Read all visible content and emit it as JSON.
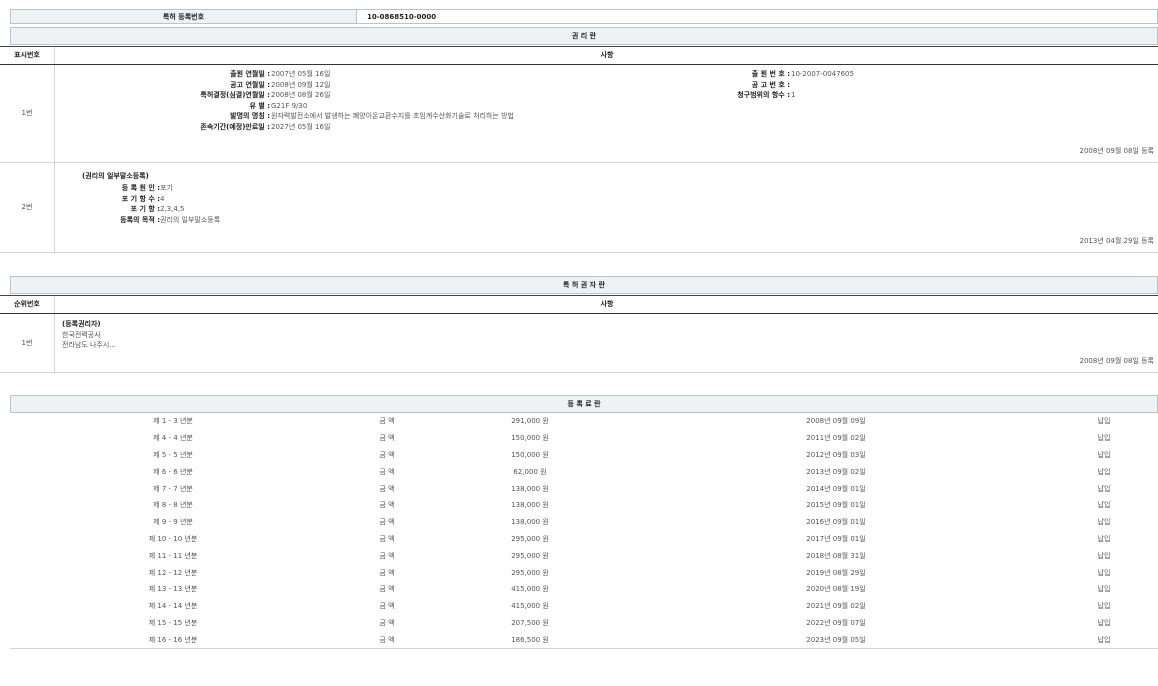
{
  "patent_number_label": "특허 등록번호",
  "patent_number_value": "10-0868510-0000",
  "section1": {
    "title": "권 리 란",
    "col_no": "표시번호",
    "col_detail": "사항",
    "entry1": {
      "no": "1번",
      "left": [
        {
          "k": "출원 연월일 :",
          "v": "2007년 05월 16일"
        },
        {
          "k": "공고 연월일 :",
          "v": "2008년 09월 12일"
        },
        {
          "k": "특허결정(심결)연월일 :",
          "v": "2008년 08월 26일"
        },
        {
          "k": "유 별 :",
          "v": "G21F 9/30"
        },
        {
          "k": "발명의 명칭 :",
          "v": "원자력발전소에서 발생하는 폐양이온교환수지를 초임계수산화기술로 처리하는 방법"
        },
        {
          "k": "존속기간(예정)만료일 :",
          "v": "2027년 05월 16일"
        }
      ],
      "right": [
        {
          "k": "출 원 번 호 :",
          "v": "10-2007-0047605"
        },
        {
          "k": "공 고 번 호 :",
          "v": ""
        },
        {
          "k": "청구범위의 항수 :",
          "v": "1"
        }
      ],
      "date": "2008년 09월 08일 등록"
    },
    "entry2": {
      "no": "2번",
      "heading": "(권리의 일부말소등록)",
      "items": [
        {
          "k": "등 록 원 인 :",
          "v": "포기"
        },
        {
          "k": "포 기 항 수 :",
          "v": "4"
        },
        {
          "k": "포 기 항 :",
          "v": "2,3,4,5"
        },
        {
          "k": "등록의 목적 :",
          "v": "권리의 일부말소등록"
        }
      ],
      "date": "2013년 04월 29일 등록"
    }
  },
  "section2": {
    "title": "특 허 권 자 란",
    "col_no": "순위번호",
    "col_detail": "사항",
    "entry1": {
      "no": "1번",
      "heading": "(등록권리자)",
      "line1": "한국전력공사",
      "line2": "전라남도 나주시...",
      "date": "2008년 09월 08일 등록"
    }
  },
  "section3": {
    "title": "등 록 료 란",
    "rows": [
      {
        "period": "제 1 - 3 년분",
        "label": "금 액",
        "amount": "291,000 원",
        "date": "2008년 09월 09일",
        "status": "납입"
      },
      {
        "period": "제 4 - 4 년분",
        "label": "금 액",
        "amount": "150,000 원",
        "date": "2011년 09월 02일",
        "status": "납입"
      },
      {
        "period": "제 5 - 5 년분",
        "label": "금 액",
        "amount": "150,000 원",
        "date": "2012년 09월 03일",
        "status": "납입"
      },
      {
        "period": "제 6 - 6 년분",
        "label": "금 액",
        "amount": "62,000 원",
        "date": "2013년 09월 02일",
        "status": "납입"
      },
      {
        "period": "제 7 - 7 년분",
        "label": "금 액",
        "amount": "138,000 원",
        "date": "2014년 09월 01일",
        "status": "납입"
      },
      {
        "period": "제 8 - 8 년분",
        "label": "금 액",
        "amount": "138,000 원",
        "date": "2015년 09월 01일",
        "status": "납입"
      },
      {
        "period": "제 9 - 9 년분",
        "label": "금 액",
        "amount": "138,000 원",
        "date": "2016년 09월 01일",
        "status": "납입"
      },
      {
        "period": "제 10 - 10 년분",
        "label": "금 액",
        "amount": "295,000 원",
        "date": "2017년 09월 01일",
        "status": "납입"
      },
      {
        "period": "제 11 - 11 년분",
        "label": "금 액",
        "amount": "295,000 원",
        "date": "2018년 08월 31일",
        "status": "납입"
      },
      {
        "period": "제 12 - 12 년분",
        "label": "금 액",
        "amount": "295,000 원",
        "date": "2019년 08월 29일",
        "status": "납입"
      },
      {
        "period": "제 13 - 13 년분",
        "label": "금 액",
        "amount": "415,000 원",
        "date": "2020년 08월 19일",
        "status": "납입"
      },
      {
        "period": "제 14 - 14 년분",
        "label": "금 액",
        "amount": "415,000 원",
        "date": "2021년 09월 02일",
        "status": "납입"
      },
      {
        "period": "제 15 - 15 년분",
        "label": "금 액",
        "amount": "207,500 원",
        "date": "2022년 09월 07일",
        "status": "납입"
      },
      {
        "period": "제 16 - 16 년분",
        "label": "금 액",
        "amount": "186,500 원",
        "date": "2023년 09월 05일",
        "status": "납입"
      }
    ]
  }
}
